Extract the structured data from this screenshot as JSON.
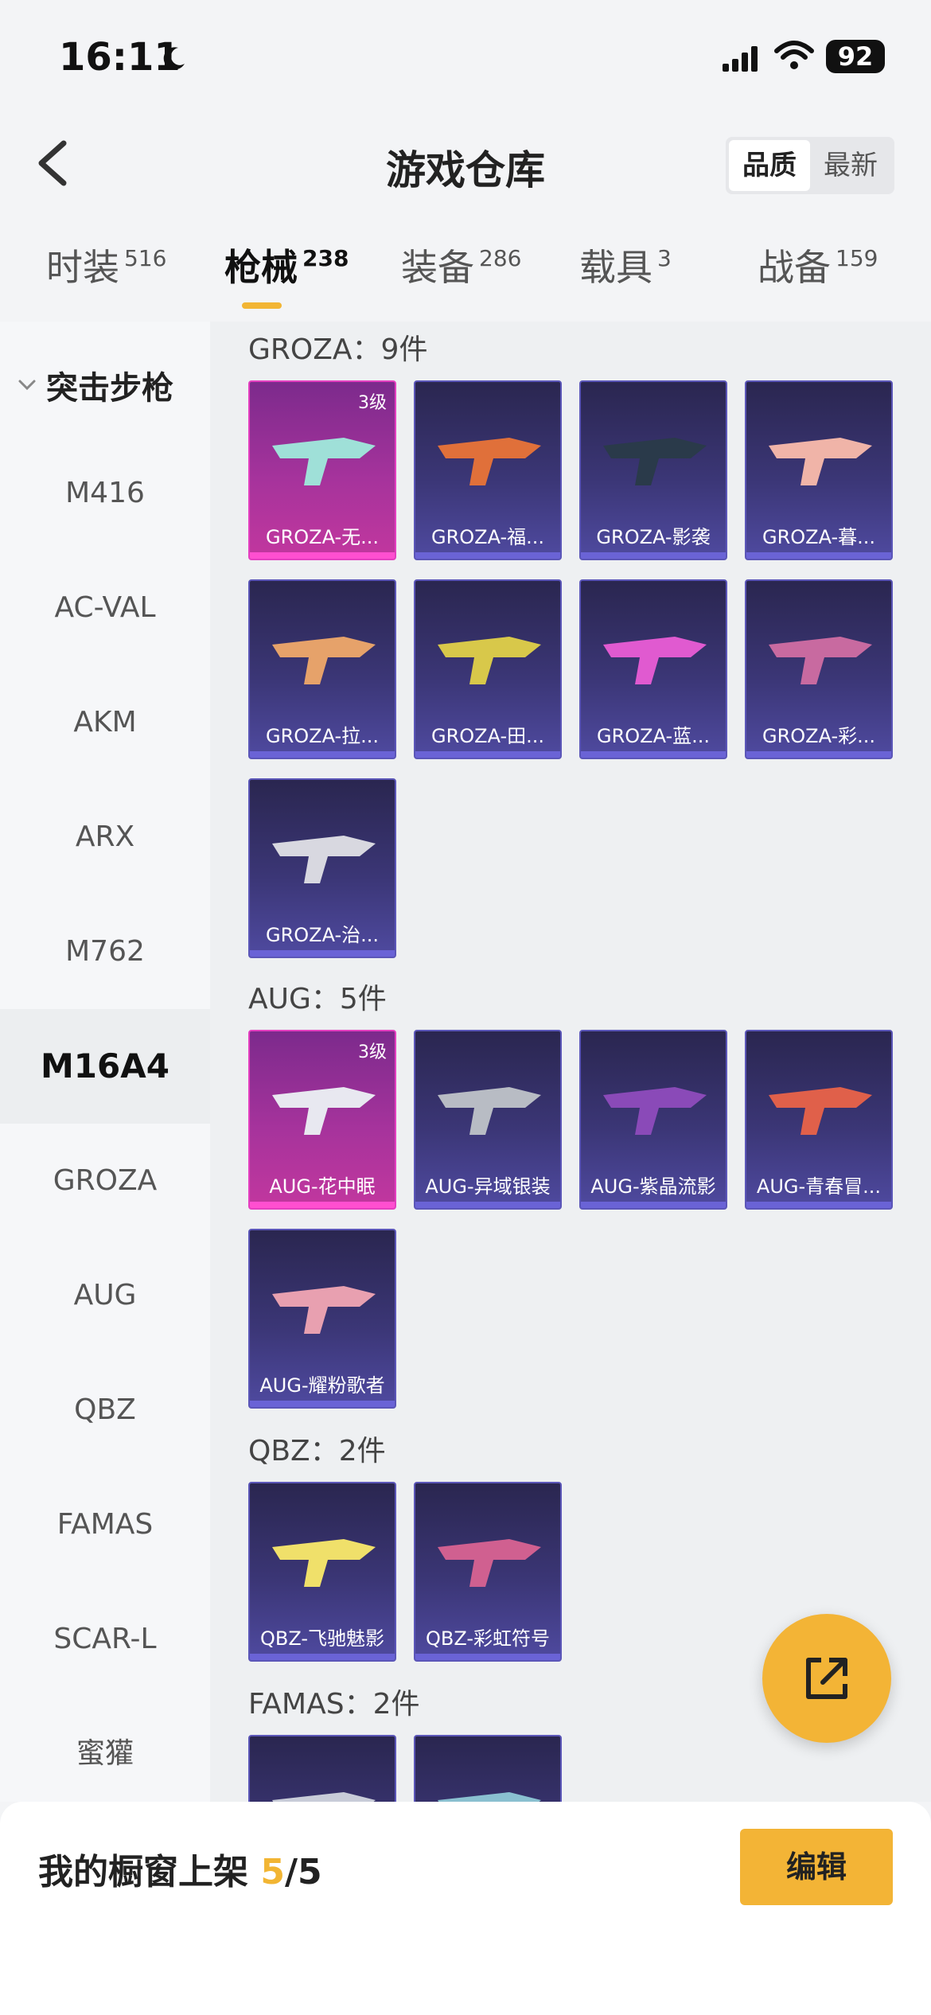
{
  "status_bar": {
    "time": "16:11",
    "battery": "92"
  },
  "header": {
    "title": "游戏仓库",
    "sort_options": [
      "品质",
      "最新"
    ],
    "active_sort": "品质"
  },
  "tabs": [
    {
      "label": "时装",
      "count": "516"
    },
    {
      "label": "枪械",
      "count": "238"
    },
    {
      "label": "装备",
      "count": "286"
    },
    {
      "label": "载具",
      "count": "3"
    },
    {
      "label": "战备",
      "count": "159"
    }
  ],
  "active_tab": "枪械",
  "sidebar": {
    "group": "突击步枪",
    "items": [
      "M416",
      "AC-VAL",
      "AKM",
      "ARX",
      "M762",
      "M16A4",
      "GROZA",
      "AUG",
      "QBZ",
      "FAMAS",
      "SCAR-L",
      "蜜獾"
    ],
    "active": "M16A4"
  },
  "sections": [
    {
      "title": "GROZA：9件",
      "items": [
        {
          "name": "GROZA-无...",
          "level": "3级",
          "rarity": "legend"
        },
        {
          "name": "GROZA-福...",
          "rarity": "epic"
        },
        {
          "name": "GROZA-影袭",
          "rarity": "epic"
        },
        {
          "name": "GROZA-暮...",
          "rarity": "epic"
        },
        {
          "name": "GROZA-拉...",
          "rarity": "epic"
        },
        {
          "name": "GROZA-田...",
          "rarity": "epic"
        },
        {
          "name": "GROZA-蓝...",
          "rarity": "epic"
        },
        {
          "name": "GROZA-彩...",
          "rarity": "epic"
        },
        {
          "name": "GROZA-治...",
          "rarity": "epic"
        }
      ]
    },
    {
      "title": "AUG：5件",
      "items": [
        {
          "name": "AUG-花中眠",
          "level": "3级",
          "rarity": "legend"
        },
        {
          "name": "AUG-异域银装",
          "rarity": "epic"
        },
        {
          "name": "AUG-紫晶流影",
          "rarity": "epic"
        },
        {
          "name": "AUG-青春冒...",
          "rarity": "epic"
        },
        {
          "name": "AUG-耀粉歌者",
          "rarity": "epic"
        }
      ]
    },
    {
      "title": "QBZ：2件",
      "items": [
        {
          "name": "QBZ-飞驰魅影",
          "rarity": "epic"
        },
        {
          "name": "QBZ-彩虹符号",
          "rarity": "epic"
        }
      ]
    },
    {
      "title": "FAMAS：2件",
      "items": [
        {
          "name": "",
          "rarity": "epic"
        },
        {
          "name": "",
          "rarity": "epic"
        }
      ]
    }
  ],
  "bottom": {
    "label": "我的橱窗上架",
    "current": "5",
    "total": "/5",
    "edit_label": "编辑"
  },
  "colors": {
    "accent": "#f3b436",
    "legend": "#c2379e",
    "epic": "#4f4aa0"
  }
}
